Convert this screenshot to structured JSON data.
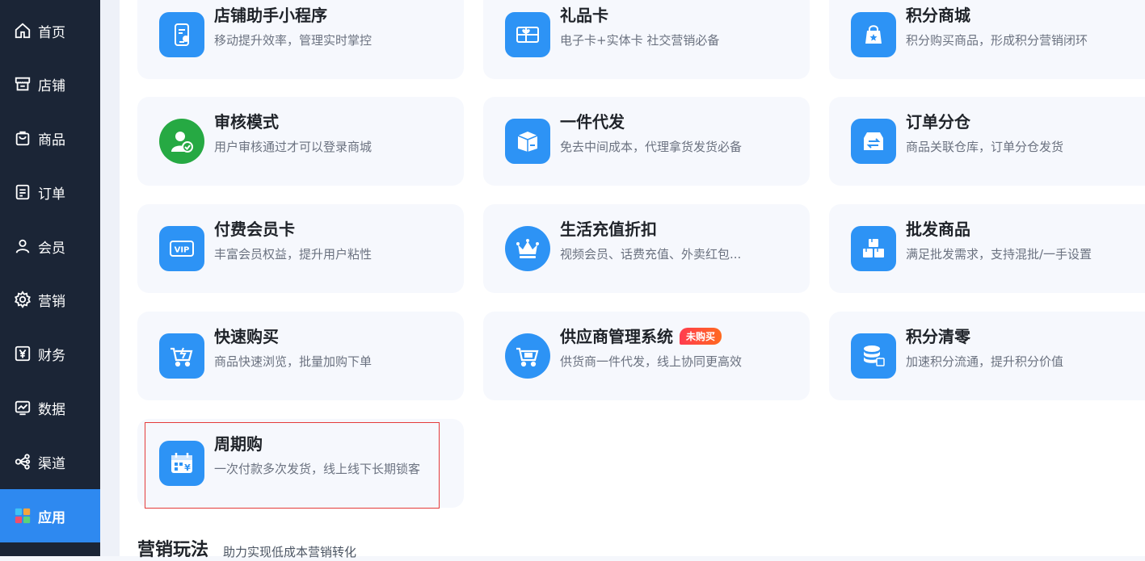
{
  "sidebar": {
    "items": [
      {
        "label": "首页",
        "icon": "home-icon"
      },
      {
        "label": "店铺",
        "icon": "store-icon"
      },
      {
        "label": "商品",
        "icon": "shopping-bag-icon"
      },
      {
        "label": "订单",
        "icon": "order-icon"
      },
      {
        "label": "会员",
        "icon": "user-icon"
      },
      {
        "label": "营销",
        "icon": "gear-icon"
      },
      {
        "label": "财务",
        "icon": "yuan-icon"
      },
      {
        "label": "数据",
        "icon": "chart-icon"
      },
      {
        "label": "渠道",
        "icon": "share-icon"
      },
      {
        "label": "应用",
        "icon": "apps-grid-icon",
        "active": true
      }
    ]
  },
  "cards": [
    {
      "title": "店铺助手小程序",
      "desc": "移动提升效率，管理实时掌控",
      "icon": "mobile-store-icon"
    },
    {
      "title": "礼品卡",
      "desc": "电子卡+实体卡 社交营销必备",
      "icon": "gift-card-icon"
    },
    {
      "title": "积分商城",
      "desc": "积分购买商品，形成积分营销闭环",
      "icon": "points-bag-icon"
    },
    {
      "title": "审核模式",
      "desc": "用户审核通过才可以登录商城",
      "icon": "user-check-icon"
    },
    {
      "title": "一件代发",
      "desc": "免去中间成本，代理拿货发货必备",
      "icon": "box-icon"
    },
    {
      "title": "订单分仓",
      "desc": "商品关联仓库，订单分仓发货",
      "icon": "warehouse-icon"
    },
    {
      "title": "付费会员卡",
      "desc": "丰富会员权益，提升用户粘性",
      "icon": "vip-card-icon"
    },
    {
      "title": "生活充值折扣",
      "desc": "视频会员、话费充值、外卖红包...",
      "icon": "crown-icon"
    },
    {
      "title": "批发商品",
      "desc": "满足批发需求，支持混批/一手设置",
      "icon": "boxes-icon"
    },
    {
      "title": "快速购买",
      "desc": "商品快速浏览，批量加购下单",
      "icon": "fast-cart-icon"
    },
    {
      "title": "供应商管理系统",
      "desc": "供货商一件代发，线上协同更高效",
      "icon": "supplier-cart-icon",
      "badge": "未购买"
    },
    {
      "title": "积分清零",
      "desc": "加速积分流通，提升积分价值",
      "icon": "database-icon"
    },
    {
      "title": "周期购",
      "desc": "一次付款多次发货，线上线下长期锁客",
      "icon": "calendar-yuan-icon"
    }
  ],
  "section": {
    "title": "营销玩法",
    "subtitle": "助力实现低成本营销转化"
  },
  "colors": {
    "sidebar_bg": "#1b2536",
    "active_bg": "#2e89f0",
    "icon_blue": "#2d93f5",
    "icon_green": "#26a943",
    "selection_outline": "#e43b3b"
  }
}
